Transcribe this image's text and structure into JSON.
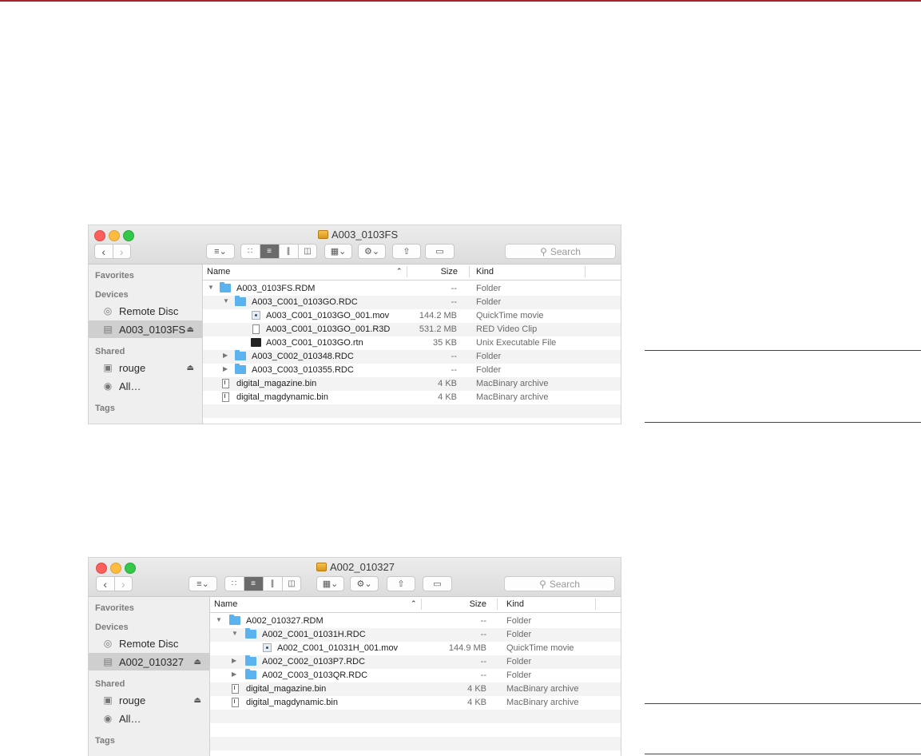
{
  "windows": [
    {
      "title": "A003_0103FS",
      "toolbar": {
        "search_placeholder": "Search"
      },
      "sidebar": {
        "favorites": "Favorites",
        "devices": "Devices",
        "shared": "Shared",
        "tags": "Tags",
        "device_items": [
          "Remote Disc",
          "A003_0103FS"
        ],
        "shared_items": [
          "rouge",
          "All…"
        ]
      },
      "columns": {
        "name": "Name",
        "size": "Size",
        "kind": "Kind"
      },
      "rows": [
        {
          "name": "A003_0103FS.RDM",
          "size": "--",
          "kind": "Folder"
        },
        {
          "name": "A003_C001_0103GO.RDC",
          "size": "--",
          "kind": "Folder"
        },
        {
          "name": "A003_C001_0103GO_001.mov",
          "size": "144.2 MB",
          "kind": "QuickTime movie"
        },
        {
          "name": "A003_C001_0103GO_001.R3D",
          "size": "531.2 MB",
          "kind": "RED Video Clip"
        },
        {
          "name": "A003_C001_0103GO.rtn",
          "size": "35 KB",
          "kind": "Unix Executable File"
        },
        {
          "name": "A003_C002_010348.RDC",
          "size": "--",
          "kind": "Folder"
        },
        {
          "name": "A003_C003_010355.RDC",
          "size": "--",
          "kind": "Folder"
        },
        {
          "name": "digital_magazine.bin",
          "size": "4 KB",
          "kind": "MacBinary archive"
        },
        {
          "name": "digital_magdynamic.bin",
          "size": "4 KB",
          "kind": "MacBinary archive"
        }
      ]
    },
    {
      "title": "A002_010327",
      "toolbar": {
        "search_placeholder": "Search"
      },
      "sidebar": {
        "favorites": "Favorites",
        "devices": "Devices",
        "shared": "Shared",
        "tags": "Tags",
        "device_items": [
          "Remote Disc",
          "A002_010327"
        ],
        "shared_items": [
          "rouge",
          "All…"
        ]
      },
      "columns": {
        "name": "Name",
        "size": "Size",
        "kind": "Kind"
      },
      "rows": [
        {
          "name": "A002_010327.RDM",
          "size": "--",
          "kind": "Folder"
        },
        {
          "name": "A002_C001_01031H.RDC",
          "size": "--",
          "kind": "Folder"
        },
        {
          "name": "A002_C001_01031H_001.mov",
          "size": "144.9 MB",
          "kind": "QuickTime movie"
        },
        {
          "name": "A002_C002_0103P7.RDC",
          "size": "--",
          "kind": "Folder"
        },
        {
          "name": "A002_C003_0103QR.RDC",
          "size": "--",
          "kind": "Folder"
        },
        {
          "name": "digital_magazine.bin",
          "size": "4 KB",
          "kind": "MacBinary archive"
        },
        {
          "name": "digital_magdynamic.bin",
          "size": "4 KB",
          "kind": "MacBinary archive"
        }
      ]
    }
  ]
}
